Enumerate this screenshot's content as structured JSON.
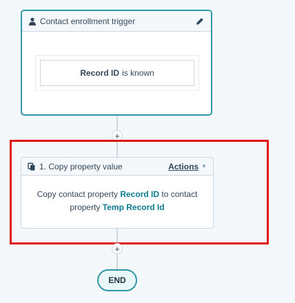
{
  "trigger": {
    "title": "Contact enrollment trigger",
    "filter_property": "Record ID",
    "filter_operator": "is known",
    "icon": "person-icon",
    "edit_icon": "pencil-icon"
  },
  "add_buttons": {
    "symbol": "+"
  },
  "action": {
    "title": "1. Copy property value",
    "menu_label": "Actions",
    "icon": "copy-icon",
    "body": {
      "text_1": "Copy contact property",
      "source_property": "Record ID",
      "text_2": "to contact property",
      "target_property": "Temp Record Id"
    }
  },
  "end": {
    "label": "END"
  },
  "colors": {
    "trigger_border": "#2e97a6",
    "highlight_border": "#e01414",
    "link_text": "#0b7a8d",
    "background": "#f5f8fa"
  }
}
